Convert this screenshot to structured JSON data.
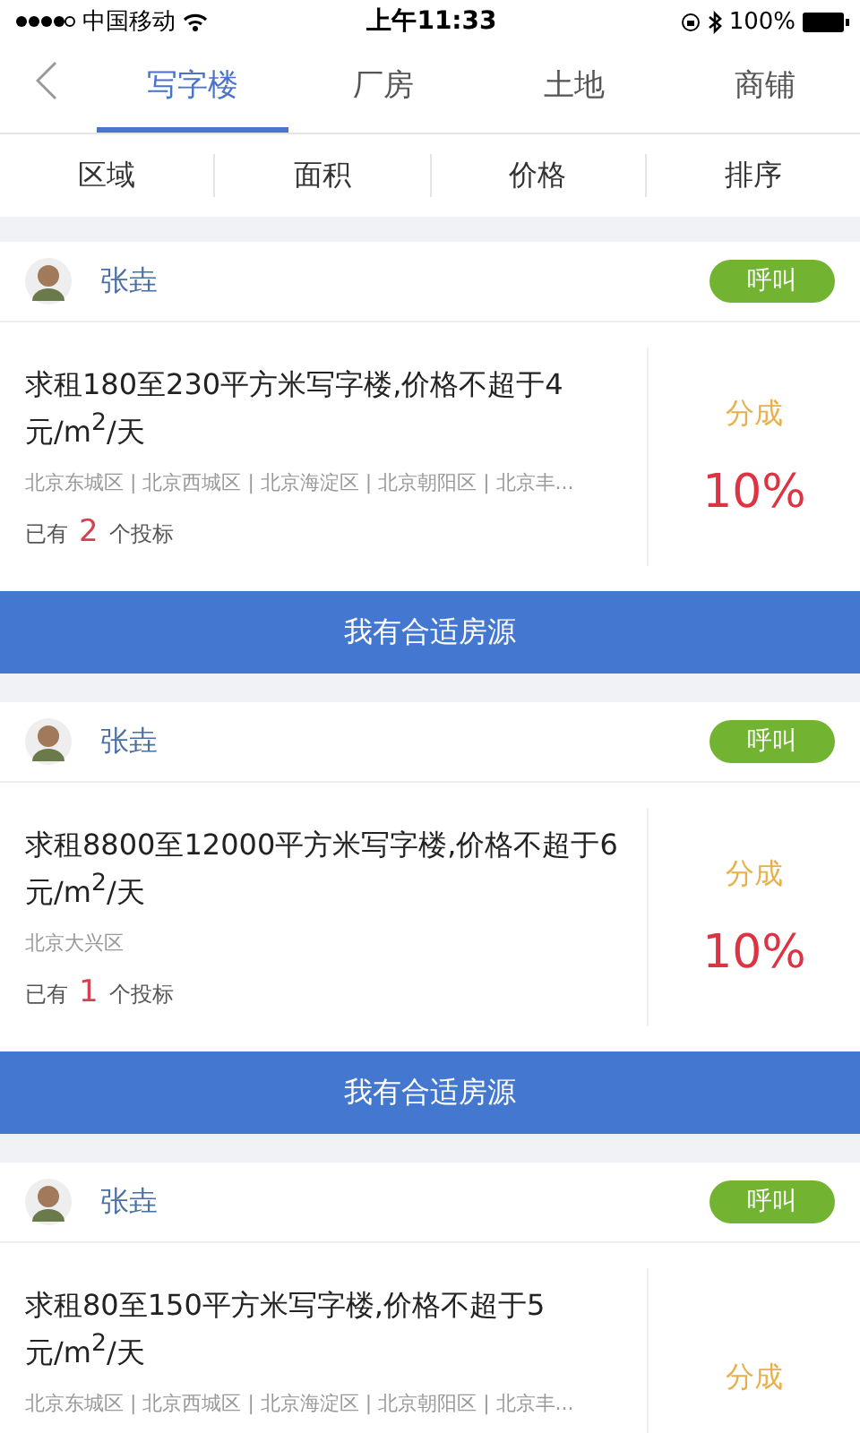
{
  "status_bar": {
    "carrier": "中国移动",
    "time": "上午11:33",
    "battery": "100%"
  },
  "tabs": [
    {
      "label": "写字楼",
      "selected": true
    },
    {
      "label": "厂房",
      "selected": false
    },
    {
      "label": "土地",
      "selected": false
    },
    {
      "label": "商铺",
      "selected": false
    }
  ],
  "filters": [
    "区域",
    "面积",
    "价格",
    "排序"
  ],
  "listings": [
    {
      "name": "张垚",
      "call": "呼叫",
      "title": "求租180至230平方米写字楼,价格不超于4元/m$^{2}$/天",
      "locations": "北京东城区 | 北京西城区 | 北京海淀区 | 北京朝阳区 | 北京丰...",
      "bids_prefix": "已有",
      "bids_count": "2",
      "bids_suffix": "个投标",
      "share_label": "分成",
      "share": "10%",
      "action": "我有合适房源"
    },
    {
      "name": "张垚",
      "call": "呼叫",
      "title": "求租8800至12000平方米写字楼,价格不超于6元/m$^{2}$/天",
      "locations": "北京大兴区",
      "bids_prefix": "已有",
      "bids_count": "1",
      "bids_suffix": "个投标",
      "share_label": "分成",
      "share": "10%",
      "action": "我有合适房源"
    },
    {
      "name": "张垚",
      "call": "呼叫",
      "title": "求租80至150平方米写字楼,价格不超于5元/m$^{2}$/天",
      "locations": "北京东城区 | 北京西城区 | 北京海淀区 | 北京朝阳区 | 北京丰...",
      "share_label": "分成"
    }
  ]
}
